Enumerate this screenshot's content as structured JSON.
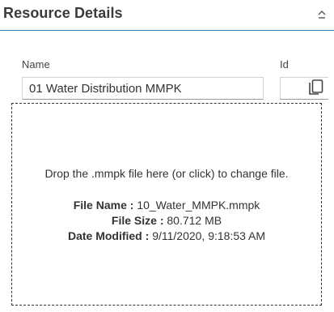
{
  "header": {
    "title": "Resource Details",
    "collapse_icon": "chevron-up-icon"
  },
  "form": {
    "name_label": "Name",
    "name_value": "01 Water Distribution MMPK",
    "id_label": "Id",
    "id_value": "",
    "copy_icon": "copy-icon"
  },
  "dropzone": {
    "instruction": "Drop the .mmpk file here (or click) to change file.",
    "file_name_label": "File Name :",
    "file_name_value": "10_Water_MMPK.mmpk",
    "file_size_label": "File Size :",
    "file_size_value": "80.712 MB",
    "date_modified_label": "Date Modified :",
    "date_modified_value": "9/11/2020, 9:18:53 AM"
  },
  "colors": {
    "accent": "#2f7fbf",
    "text": "#333333"
  }
}
